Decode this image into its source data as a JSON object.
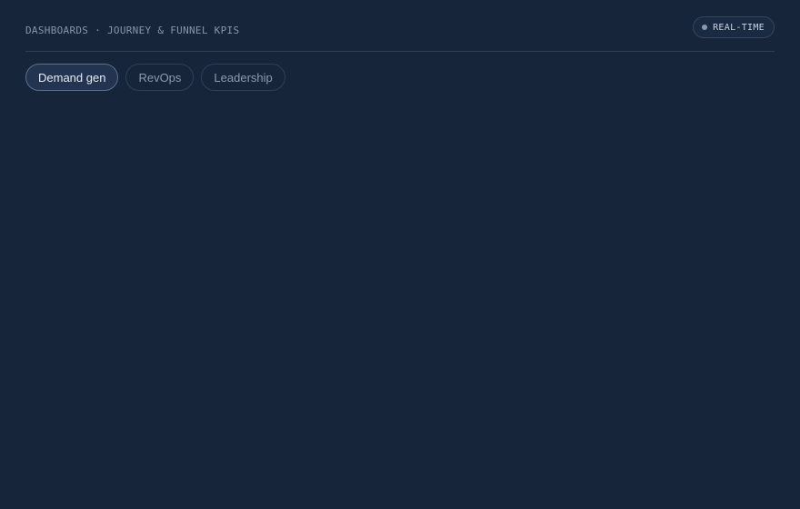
{
  "header": {
    "breadcrumb": "DASHBOARDS · JOURNEY & FUNNEL KPIS",
    "status": {
      "label": "REAL-TIME",
      "dot_color": "#8c97a8"
    }
  },
  "tabs": [
    {
      "label": "Demand gen",
      "active": true
    },
    {
      "label": "RevOps",
      "active": false
    },
    {
      "label": "Leadership",
      "active": false
    }
  ],
  "colors": {
    "background": "#17253b",
    "active_tab_bg": "#22344f",
    "muted_text": "#8c9ab0"
  }
}
